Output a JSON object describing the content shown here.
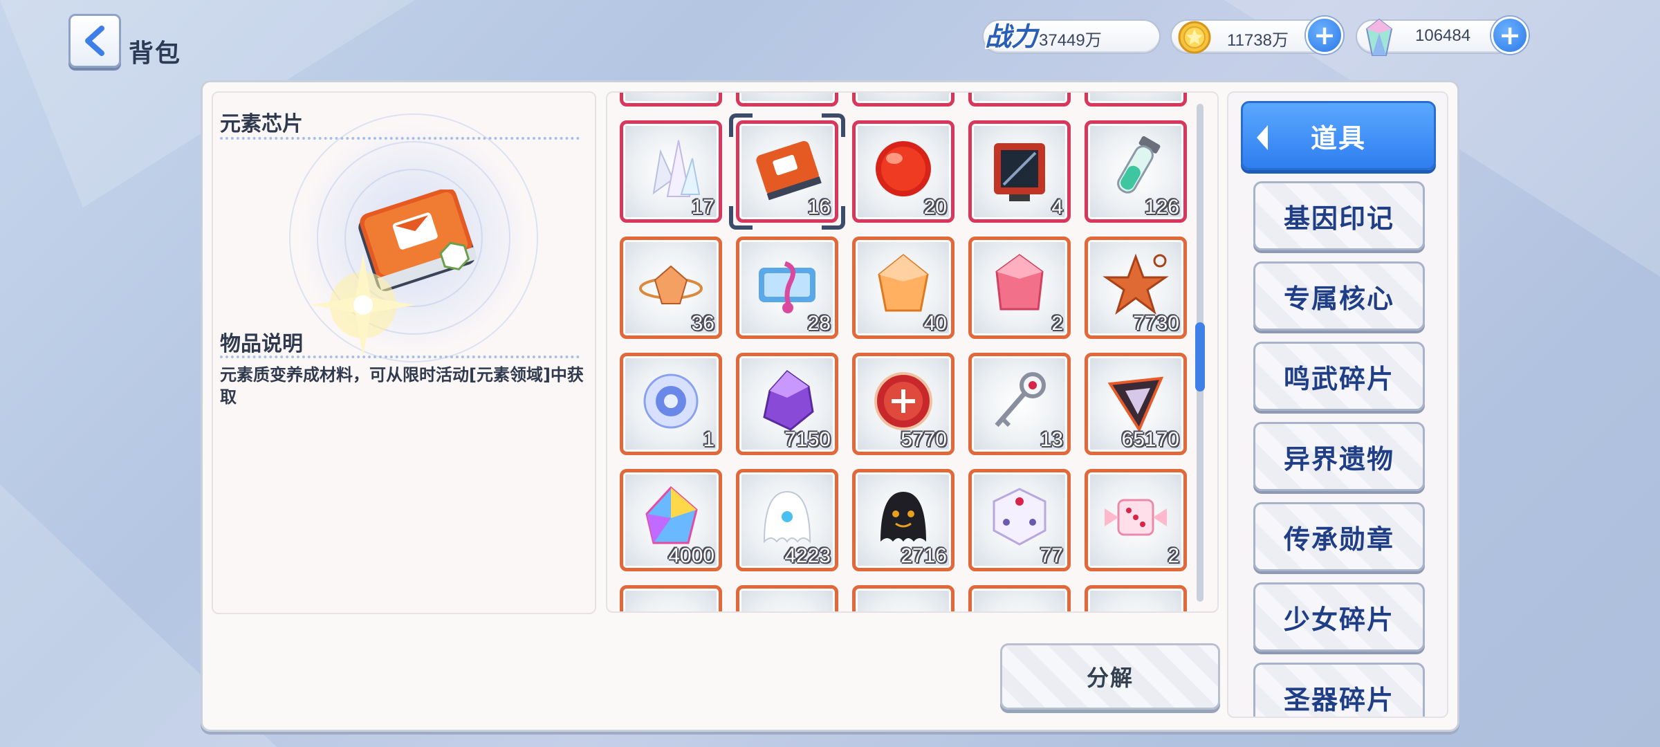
{
  "header": {
    "title": "背包"
  },
  "resources": {
    "power_label": "战力",
    "power_value": "37449万",
    "gold_value": "11738万",
    "gem_value": "106484"
  },
  "detail": {
    "item_name": "元素芯片",
    "desc_heading": "物品说明",
    "description": "元素质变养成材料，可从限时活动[元素领域]中获取"
  },
  "items": [
    {
      "qty": "17",
      "icon": "crystal-cluster-icon",
      "rarity": "red"
    },
    {
      "qty": "16",
      "icon": "element-chip-icon",
      "rarity": "red",
      "selected": true
    },
    {
      "qty": "20",
      "icon": "red-orb-icon",
      "rarity": "red"
    },
    {
      "qty": "4",
      "icon": "circuit-board-icon",
      "rarity": "red"
    },
    {
      "qty": "126",
      "icon": "test-tube-icon",
      "rarity": "red"
    },
    {
      "qty": "36",
      "icon": "orbit-crystal-icon",
      "rarity": "orange"
    },
    {
      "qty": "28",
      "icon": "music-note-icon",
      "rarity": "orange"
    },
    {
      "qty": "40",
      "icon": "orange-gem-icon",
      "rarity": "orange"
    },
    {
      "qty": "2",
      "icon": "pink-gem-icon",
      "rarity": "orange"
    },
    {
      "qty": "7730",
      "icon": "star-medal-icon",
      "rarity": "orange"
    },
    {
      "qty": "1",
      "icon": "blue-swirl-icon",
      "rarity": "orange"
    },
    {
      "qty": "7150",
      "icon": "purple-crystal-icon",
      "rarity": "orange"
    },
    {
      "qty": "5770",
      "icon": "red-coin-icon",
      "rarity": "orange"
    },
    {
      "qty": "13",
      "icon": "key-icon",
      "rarity": "orange"
    },
    {
      "qty": "65170",
      "icon": "dark-shard-icon",
      "rarity": "orange"
    },
    {
      "qty": "4000",
      "icon": "rainbow-crystal-icon",
      "rarity": "orange"
    },
    {
      "qty": "4223",
      "icon": "white-ghost-icon",
      "rarity": "orange"
    },
    {
      "qty": "2716",
      "icon": "black-ghost-icon",
      "rarity": "orange"
    },
    {
      "qty": "77",
      "icon": "dice-icon",
      "rarity": "orange"
    },
    {
      "qty": "2",
      "icon": "candy-dice-icon",
      "rarity": "orange"
    }
  ],
  "actions": {
    "decompose": "分解"
  },
  "tabs": [
    {
      "label": "道具",
      "active": true
    },
    {
      "label": "基因印记"
    },
    {
      "label": "专属核心"
    },
    {
      "label": "鸣武碎片"
    },
    {
      "label": "异界遗物"
    },
    {
      "label": "传承勋章"
    },
    {
      "label": "少女碎片"
    },
    {
      "label": "圣器碎片"
    }
  ],
  "colors": {
    "accent_blue": "#2f7ef0",
    "slot_red": "#d8365a",
    "slot_orange": "#e2683a",
    "tab_text": "#1f3e86"
  }
}
